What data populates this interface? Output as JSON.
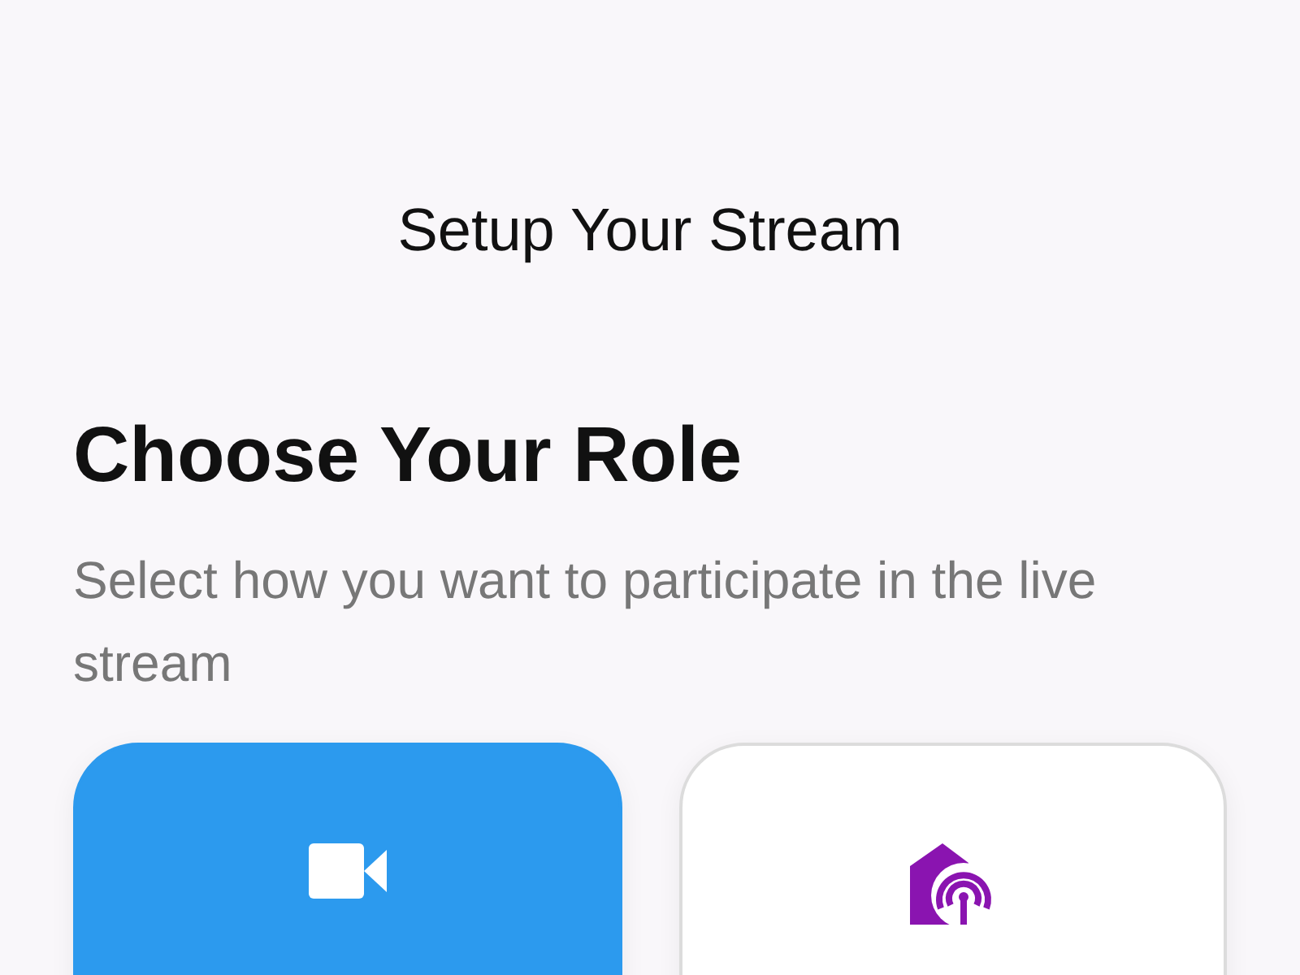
{
  "header": {
    "title": "Setup Your Stream"
  },
  "heading": "Choose Your Role",
  "subtitle": "Select how you want to participate in the live stream",
  "roles": [
    {
      "kind": "camera",
      "selected": true
    },
    {
      "kind": "broadcast",
      "selected": false
    }
  ]
}
